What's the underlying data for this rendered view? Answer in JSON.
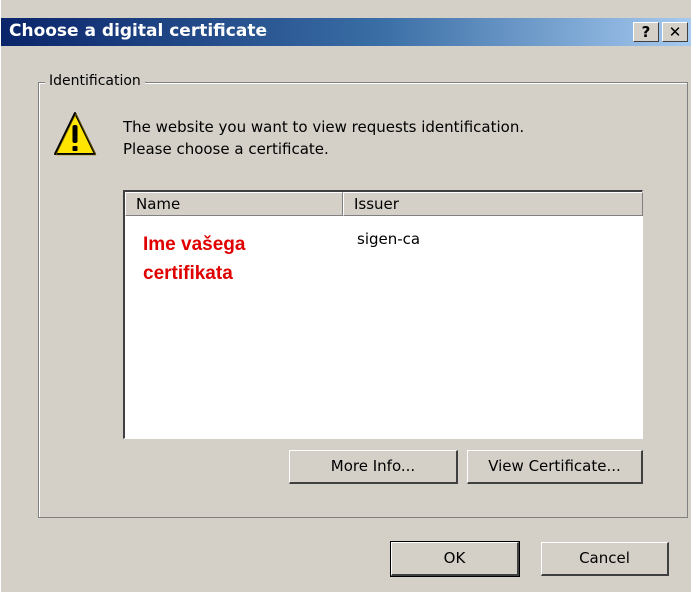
{
  "window": {
    "title": "Choose a digital certificate",
    "help_label": "?",
    "close_label": "✕"
  },
  "group": {
    "label": "Identification",
    "message_line1": "The website you want to view requests identification.",
    "message_line2": "Please choose a certificate."
  },
  "list": {
    "columns": [
      "Name",
      "Issuer"
    ],
    "rows": [
      {
        "name_line1": "Ime vašega",
        "name_line2": "certifikata",
        "issuer": "sigen-ca"
      }
    ]
  },
  "buttons": {
    "more_info": "More Info...",
    "view_certificate": "View Certificate...",
    "ok": "OK",
    "cancel": "Cancel"
  },
  "colors": {
    "titlebar_start": "#0a246a",
    "titlebar_end": "#a6caf0",
    "dialog_face": "#d4d0c8",
    "highlight_text": "#e00000"
  },
  "icons": {
    "warning": "warning-icon"
  }
}
